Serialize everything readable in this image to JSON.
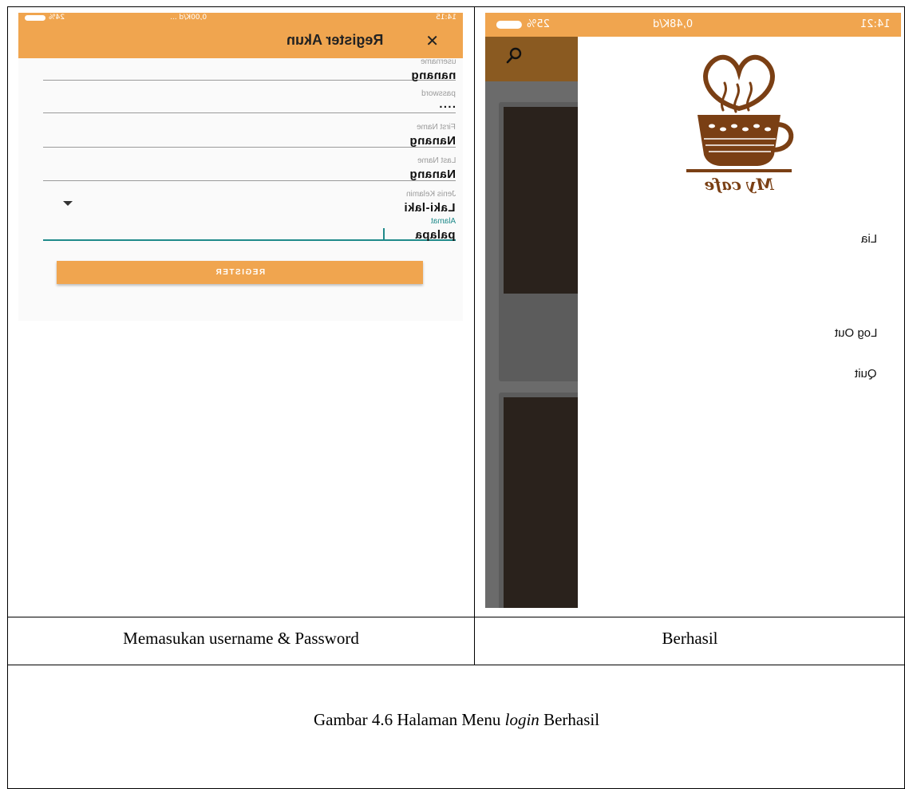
{
  "left_screen": {
    "status": {
      "time": "14:15",
      "network": "0,00K/d ...",
      "battery": "24%"
    },
    "title": "Register Akun",
    "close_icon": "close-icon",
    "fields": [
      {
        "label": "username",
        "value": "nanang"
      },
      {
        "label": "password",
        "value": "····"
      },
      {
        "label": "First Name",
        "value": "Nanang"
      },
      {
        "label": "Last Name",
        "value": "Nanang"
      },
      {
        "label": "Jenis Kelamin",
        "value": "Laki-laki"
      },
      {
        "label": "Alamat",
        "value": "palapa"
      }
    ],
    "register_label": "REGISTER"
  },
  "right_screen": {
    "status": {
      "time": "14:21",
      "network": "0,48K/d",
      "battery": "25%"
    },
    "search_icon": "search-icon",
    "logo_text": "My cafe",
    "drawer": {
      "user": "Lia",
      "logout": "Log Out",
      "quit": "Quit"
    }
  },
  "captions": {
    "left": "Memasukan username & Password",
    "right": "Berhasil",
    "figure_prefix": "Gambar 4.6 Halaman Menu ",
    "figure_italic": "login",
    "figure_suffix": " Berhasil"
  },
  "colors": {
    "accent": "#f0a54f",
    "focus": "#1f8a8a",
    "toolbar_dark": "#8a5a21"
  }
}
